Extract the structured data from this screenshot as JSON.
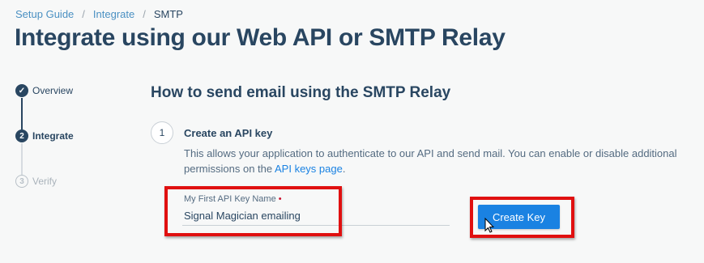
{
  "breadcrumb": {
    "items": [
      "Setup Guide",
      "Integrate",
      "SMTP"
    ],
    "separator": "/"
  },
  "page_title": "Integrate using our Web API or SMTP Relay",
  "steps": [
    {
      "label": "Overview",
      "status": "done",
      "marker": "✓"
    },
    {
      "label": "Integrate",
      "status": "active",
      "marker": "2"
    },
    {
      "label": "Verify",
      "status": "pending",
      "marker": "3"
    }
  ],
  "section_title": "How to send email using the SMTP Relay",
  "substep": {
    "number": "1",
    "title": "Create an API key",
    "description_before": "This allows your application to authenticate to our API and send mail. You can enable or disable additional permissions on the ",
    "link_text": "API keys page",
    "description_after": "."
  },
  "api_key_field": {
    "label": "My First API Key Name",
    "required_marker": "•",
    "value": "Signal Magician emailing"
  },
  "create_button": {
    "label": "Create Key"
  },
  "colors": {
    "primary": "#1a82e2",
    "text": "#294661",
    "highlight": "#e01010"
  },
  "icons": {
    "done_step": "checkmark-icon",
    "cursor": "mouse-pointer-icon"
  }
}
